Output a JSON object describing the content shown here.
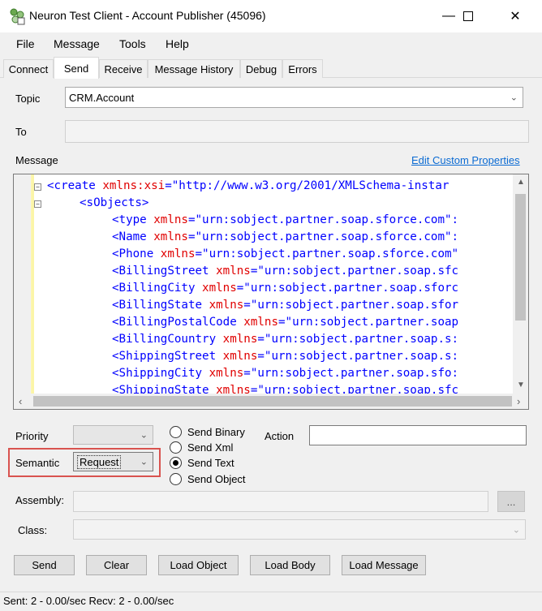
{
  "window": {
    "title": "Neuron Test Client - Account Publisher (45096)",
    "minimize_glyph": "—",
    "maximize_glyph": "☐",
    "close_glyph": "✕"
  },
  "menu": [
    "File",
    "Message",
    "Tools",
    "Help"
  ],
  "tabs": [
    {
      "label": "Connect",
      "active": false
    },
    {
      "label": "Send",
      "active": true
    },
    {
      "label": "Receive",
      "active": false
    },
    {
      "label": "Message History",
      "active": false
    },
    {
      "label": "Debug",
      "active": false
    },
    {
      "label": "Errors",
      "active": false
    }
  ],
  "form": {
    "topic_label": "Topic",
    "topic_value": "CRM.Account",
    "to_label": "To",
    "to_value": "",
    "message_label": "Message",
    "edit_custom_properties": "Edit Custom Properties"
  },
  "editor": {
    "lines": [
      {
        "indent": 0,
        "tag": "<create",
        "attr": " xmlns:xsi",
        "eq": "=",
        "val": "\"http://www.w3.org/2001/XMLSchema-instar"
      },
      {
        "indent": 1,
        "tag": "<sObjects>",
        "attr": "",
        "eq": "",
        "val": ""
      },
      {
        "indent": 2,
        "tag": "<type",
        "attr": " xmlns",
        "eq": "=",
        "val": "\"urn:sobject.partner.soap.sforce.com\":"
      },
      {
        "indent": 2,
        "tag": "<Name",
        "attr": " xmlns",
        "eq": "=",
        "val": "\"urn:sobject.partner.soap.sforce.com\":"
      },
      {
        "indent": 2,
        "tag": "<Phone",
        "attr": " xmlns",
        "eq": "=",
        "val": "\"urn:sobject.partner.soap.sforce.com\""
      },
      {
        "indent": 2,
        "tag": "<BillingStreet",
        "attr": " xmlns",
        "eq": "=",
        "val": "\"urn:sobject.partner.soap.sfc"
      },
      {
        "indent": 2,
        "tag": "<BillingCity",
        "attr": " xmlns",
        "eq": "=",
        "val": "\"urn:sobject.partner.soap.sforc"
      },
      {
        "indent": 2,
        "tag": "<BillingState",
        "attr": " xmlns",
        "eq": "=",
        "val": "\"urn:sobject.partner.soap.sfor"
      },
      {
        "indent": 2,
        "tag": "<BillingPostalCode",
        "attr": " xmlns",
        "eq": "=",
        "val": "\"urn:sobject.partner.soap"
      },
      {
        "indent": 2,
        "tag": "<BillingCountry",
        "attr": " xmlns",
        "eq": "=",
        "val": "\"urn:sobject.partner.soap.s:"
      },
      {
        "indent": 2,
        "tag": "<ShippingStreet",
        "attr": " xmlns",
        "eq": "=",
        "val": "\"urn:sobject.partner.soap.s:"
      },
      {
        "indent": 2,
        "tag": "<ShippingCity",
        "attr": " xmlns",
        "eq": "=",
        "val": "\"urn:sobject.partner.soap.sfo:"
      },
      {
        "indent": 2,
        "tag": "<ShippingState",
        "attr": " xmlns",
        "eq": "=",
        "val": "\"urn:sobject.partner.soap.sfc"
      }
    ]
  },
  "options": {
    "priority_label": "Priority",
    "priority_value": "",
    "semantic_label": "Semantic",
    "semantic_value": "Request",
    "send_modes": [
      {
        "label": "Send Binary",
        "checked": false
      },
      {
        "label": "Send Xml",
        "checked": false
      },
      {
        "label": "Send Text",
        "checked": true
      },
      {
        "label": "Send Object",
        "checked": false
      }
    ],
    "action_label": "Action",
    "action_value": "",
    "assembly_label": "Assembly:",
    "assembly_value": "",
    "browse_label": "...",
    "class_label": "Class:",
    "class_value": ""
  },
  "buttons": {
    "send": "Send",
    "clear": "Clear",
    "load_object": "Load Object",
    "load_body": "Load Body",
    "load_message": "Load Message"
  },
  "status": {
    "text": "Sent: 2  -  0.00/sec  Recv: 2  -  0.00/sec"
  },
  "colors": {
    "accent_link": "#0b6bd3",
    "xml_tag": "#0000ff",
    "xml_attr": "#e00000",
    "highlight_box": "#d9534f"
  }
}
